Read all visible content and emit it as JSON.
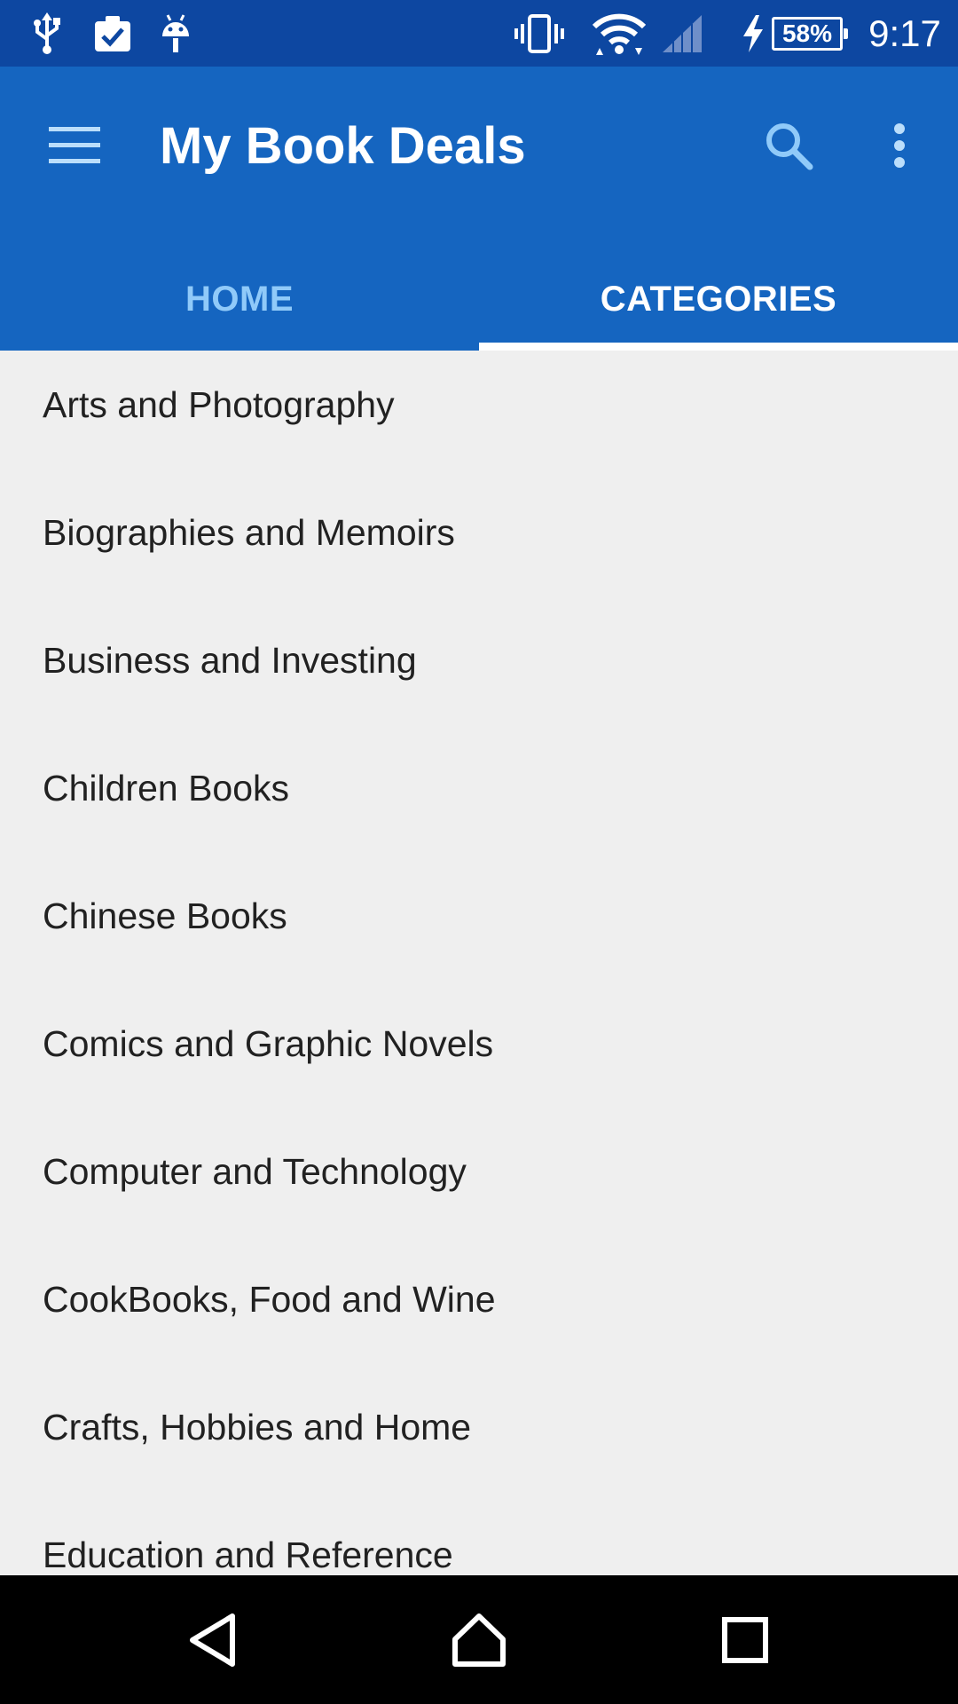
{
  "status_bar": {
    "battery_percent": "58%",
    "time": "9:17",
    "icons": [
      "usb-icon",
      "clipboard-check-icon",
      "android-icon",
      "vibrate-icon",
      "wifi-icon",
      "cell-signal-icon",
      "charging-icon",
      "battery-icon"
    ]
  },
  "app_bar": {
    "title": "My Book Deals",
    "icons": [
      "menu-icon",
      "search-icon",
      "more-vert-icon"
    ]
  },
  "tabs": [
    {
      "label": "HOME",
      "active": false
    },
    {
      "label": "CATEGORIES",
      "active": true
    }
  ],
  "categories": [
    "Arts and Photography",
    "Biographies and Memoirs",
    "Business and Investing",
    "Children Books",
    "Chinese Books",
    "Comics and Graphic Novels",
    "Computer and Technology",
    "CookBooks, Food and Wine",
    "Crafts, Hobbies and Home",
    "Education and Reference"
  ],
  "nav_bar": {
    "icons": [
      "back-icon",
      "home-icon",
      "recents-icon"
    ]
  },
  "colors": {
    "status_bar": "#0d47a1",
    "app_bar": "#1565c0",
    "tab_inactive": "#90caf9",
    "tab_active": "#ffffff",
    "list_background": "#efefef",
    "list_text": "#212121",
    "nav_bar": "#000000"
  }
}
